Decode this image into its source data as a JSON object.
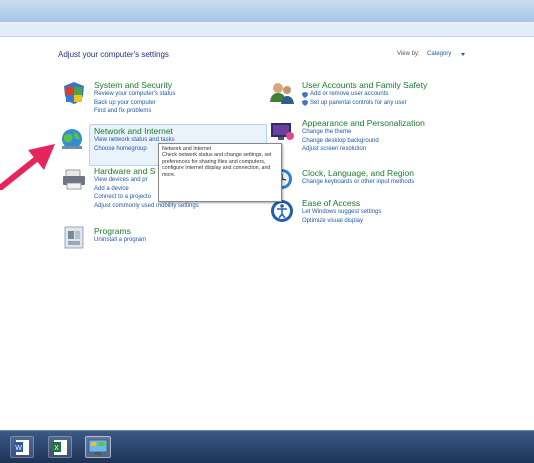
{
  "heading": "Adjust your computer's settings",
  "view_by_label": "View by:",
  "view_by_value": "Category",
  "categories": {
    "system": {
      "title": "System and Security",
      "links": [
        "Review your computer's status",
        "Back up your computer",
        "Find and fix problems"
      ]
    },
    "network": {
      "title": "Network and Internet",
      "links": [
        "View network status and tasks",
        "Choose homegroup"
      ]
    },
    "hardware": {
      "title": "Hardware and S",
      "links": [
        "View devices and pr",
        "Add a device",
        "Connect to a projecto",
        "Adjust commonly used mobility settings"
      ]
    },
    "programs": {
      "title": "Programs",
      "links": [
        "Uninstall a program"
      ]
    },
    "user_accounts": {
      "title": "User Accounts and Family Safety",
      "links": [
        "Add or remove user accounts",
        "Set up parental controls for any user"
      ]
    },
    "appearance": {
      "title": "Appearance and Personalization",
      "links": [
        "Change the theme",
        "Change desktop background",
        "Adjust screen resolution"
      ]
    },
    "clock": {
      "title": "Clock, Language, and Region",
      "links": [
        "Change keyboards or other input methods"
      ]
    },
    "ease": {
      "title": "Ease of Access",
      "links": [
        "Let Windows suggest settings",
        "Optimize visual display"
      ]
    }
  },
  "tooltip": {
    "title": "Network and Internet",
    "body": "Check network status and change settings, set preferences for sharing files and computers, configure Internet display and connection, and more."
  },
  "colors": {
    "category_title": "#1b7a2a",
    "link": "#1e5aa8",
    "heading": "#1e3287",
    "pointer": "#e8245f"
  },
  "taskbar": {
    "items": [
      "word-icon",
      "excel-icon",
      "control-panel-icon"
    ]
  }
}
